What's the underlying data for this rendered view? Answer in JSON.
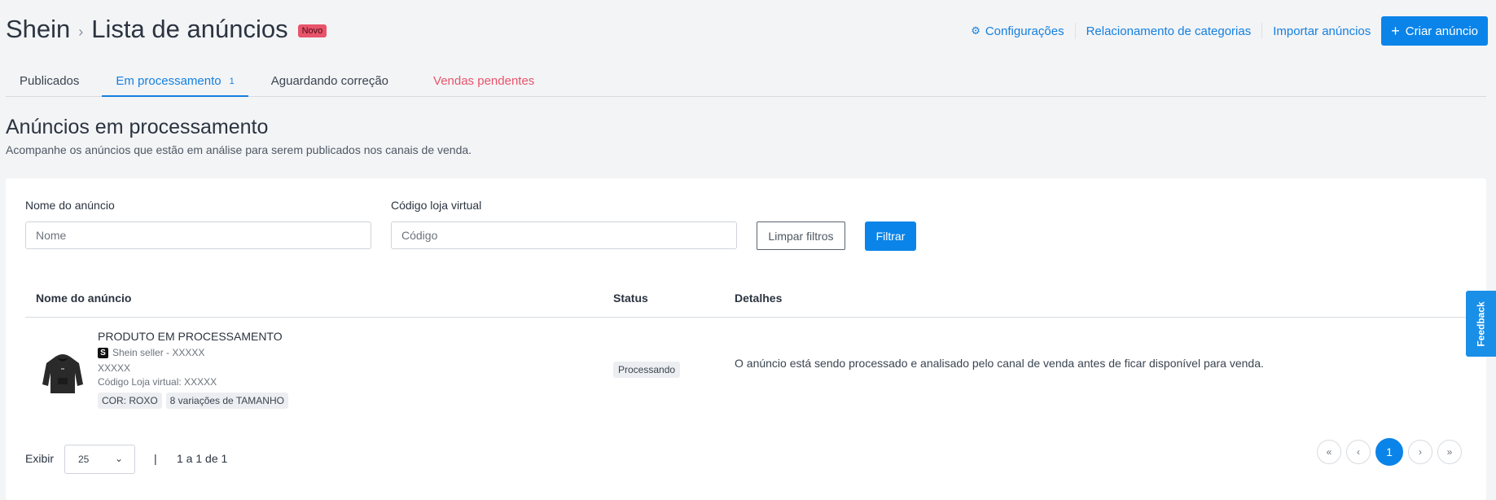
{
  "header": {
    "store": "Shein",
    "separator": "›",
    "page_title": "Lista de anúncios",
    "badge": "Novo"
  },
  "actions": {
    "settings": "Configurações",
    "categories": "Relacionamento de categorias",
    "import": "Importar anúncios",
    "create_icon": "+",
    "create": "Criar anúncio"
  },
  "tabs": [
    {
      "label": "Publicados"
    },
    {
      "label": "Em processamento",
      "count": "1"
    },
    {
      "label": "Aguardando correção"
    },
    {
      "label": "Vendas pendentes"
    }
  ],
  "section": {
    "title": "Anúncios em processamento",
    "subtitle": "Acompanhe os anúncios que estão em análise para serem publicados nos canais de venda."
  },
  "filters": {
    "name_label": "Nome do anúncio",
    "name_placeholder": "Nome",
    "code_label": "Código loja virtual",
    "code_placeholder": "Código",
    "clear": "Limpar filtros",
    "apply": "Filtrar"
  },
  "table": {
    "headers": [
      "Nome do anúncio",
      "Status",
      "Detalhes"
    ],
    "rows": [
      {
        "name": "PRODUTO EM PROCESSAMENTO",
        "seller_badge": "S",
        "seller": "Shein seller - XXXXX",
        "sku": "XXXXX",
        "store_code": "Código Loja virtual: XXXXX",
        "chips": [
          "COR: ROXO",
          "8 variações de TAMANHO"
        ],
        "status": "Processando",
        "details": "O anúncio está sendo processado e analisado pelo canal de venda antes de ficar disponível para venda."
      }
    ]
  },
  "pagination": {
    "show_label": "Exibir",
    "page_size": "25",
    "separator": "|",
    "range": "1 a 1 de 1",
    "first": "«",
    "prev": "‹",
    "current": "1",
    "next": "›",
    "last": "»"
  },
  "feedback": "Feedback",
  "colors": {
    "primary": "#0a84e8",
    "danger": "#e8546b",
    "background": "#f3f4f6"
  }
}
